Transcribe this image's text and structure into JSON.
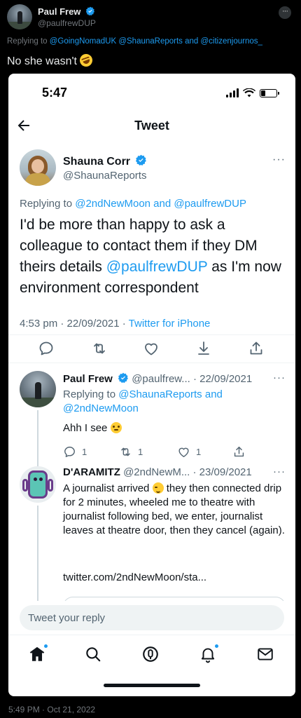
{
  "outer": {
    "author_name": "Paul Frew",
    "author_handle": "@paulfrewDUP",
    "replying_prefix": "Replying to ",
    "replying_to": "@GoingNomadUK @ShaunaReports and @citizenjournos_",
    "text": "No she wasn't",
    "emoji": "rolling-on-floor-laughing",
    "timestamp": "5:49 PM · Oct 21, 2022"
  },
  "status_bar": {
    "time": "5:47"
  },
  "nav": {
    "title": "Tweet"
  },
  "main_tweet": {
    "author_name": "Shauna Corr",
    "author_handle": "@ShaunaReports",
    "replying_prefix": "Replying to ",
    "replying_to": "@2ndNewMoon and @paulfrewDUP",
    "text_before": "I'd be more than happy to ask a colleague to contact them if they DM theirs details ",
    "text_mention": "@paulfrewDUP",
    "text_after": " as I'm now environment correspondent",
    "time_date": "4:53 pm · 22/09/2021 · ",
    "source": "Twitter for iPhone"
  },
  "replies": [
    {
      "author_name": "Paul Frew",
      "meta": "@paulfrew... · 22/09/2021",
      "replying_prefix": "Replying to ",
      "replying_to_line1": "@ShaunaReports and",
      "replying_to_line2": "@2ndNewMoon",
      "text": "Ahh I see",
      "emoji": "flushed-face",
      "reply_count": "1",
      "retweet_count": "1",
      "like_count": "1"
    },
    {
      "author_name": "D'ARAMITZ",
      "meta": "@2ndNewM... · 23/09/2021",
      "text_before": "A journalist arrived",
      "emoji": "winking-face",
      "text_after": "they then connected drip for 2 minutes, wheeled me to theatre with journalist following bed, we enter, journalist leaves at theatre door, then they cancel (again).",
      "link": "twitter.com/2ndNewMoon/sta..."
    }
  ],
  "reply_bar": {
    "placeholder": "Tweet your reply"
  },
  "tab_bar": [
    "home-icon",
    "search-icon",
    "spaces-icon",
    "notifications-icon",
    "messages-icon"
  ],
  "colors": {
    "accent": "#1d9bf0",
    "dark_bg": "#000000",
    "muted": "#536471"
  }
}
